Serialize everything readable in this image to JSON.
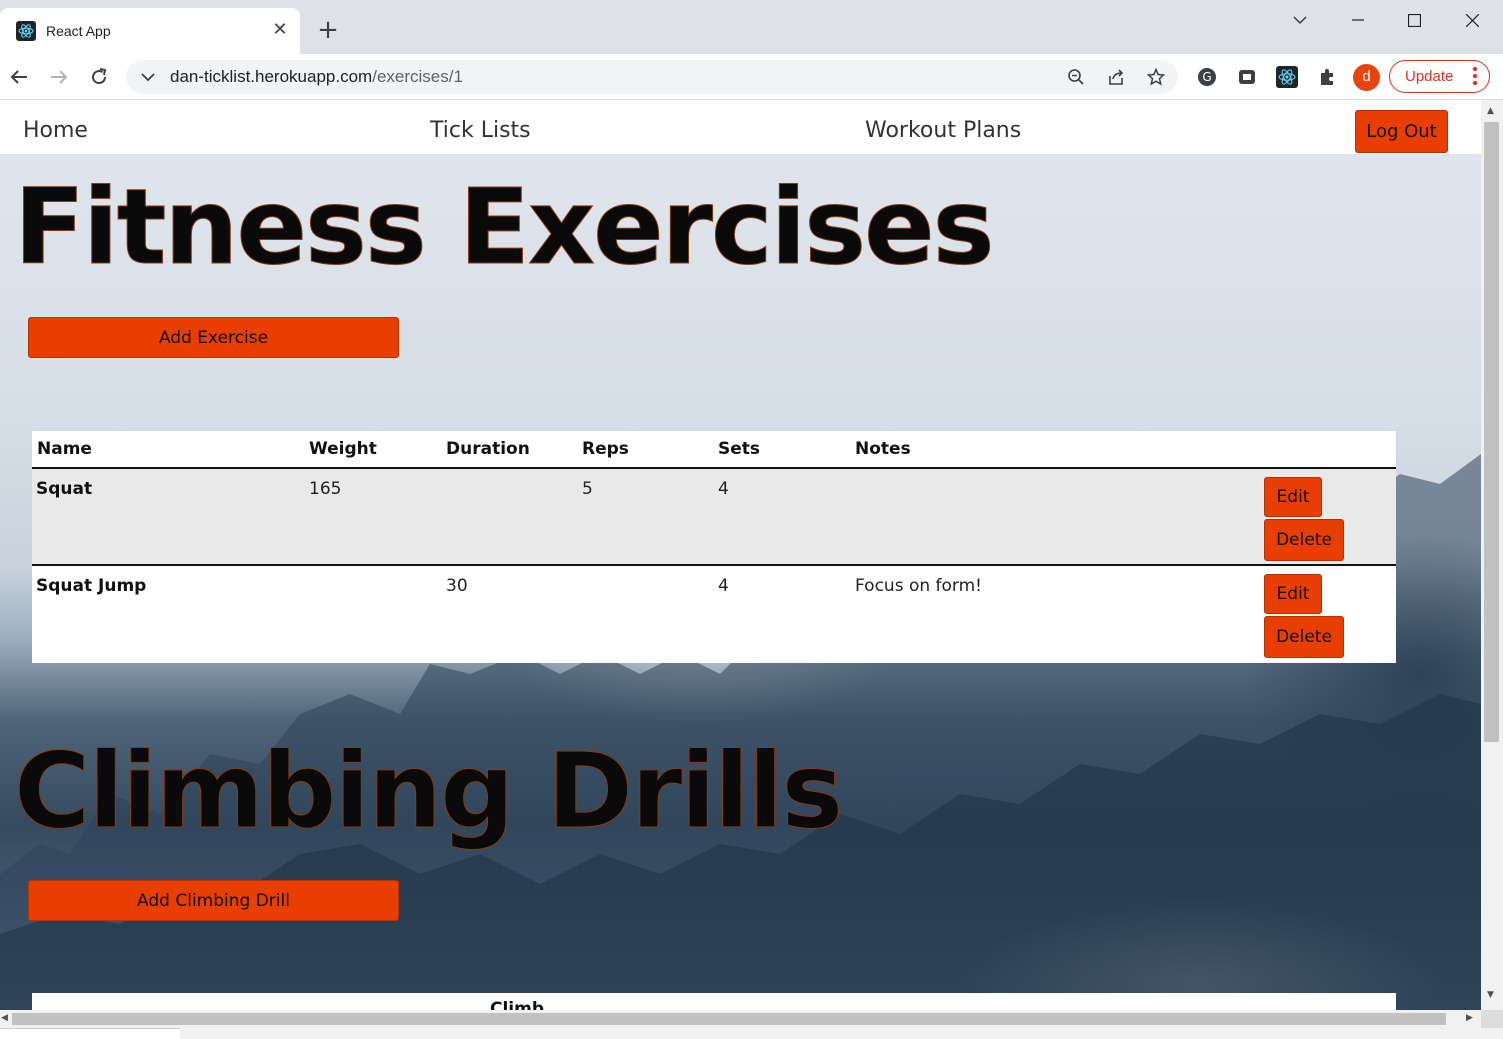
{
  "browser": {
    "tab_title": "React App",
    "close_glyph": "✕",
    "new_tab_glyph": "+",
    "url_host": "dan-ticklist.herokuapp.com",
    "url_path": "/exercises/1",
    "profile_initial": "d",
    "update_label": "Update"
  },
  "nav": {
    "home": "Home",
    "tick_lists": "Tick Lists",
    "workout_plans": "Workout Plans",
    "logout": "Log Out"
  },
  "fitness": {
    "heading": "Fitness Exercises",
    "add_label": "Add Exercise",
    "columns": [
      "Name",
      "Weight",
      "Duration",
      "Reps",
      "Sets",
      "Notes"
    ],
    "rows": [
      {
        "name": "Squat",
        "weight": "165",
        "duration": "",
        "reps": "5",
        "sets": "4",
        "notes": "",
        "edit": "Edit",
        "delete": "Delete"
      },
      {
        "name": "Squat Jump",
        "weight": "",
        "duration": "30",
        "reps": "",
        "sets": "4",
        "notes": "Focus on form!",
        "edit": "Edit",
        "delete": "Delete"
      }
    ]
  },
  "climbing": {
    "heading": "Climbing Drills",
    "add_label": "Add Climbing Drill",
    "partial_header": "Climb"
  },
  "colors": {
    "accent": "#e83e00",
    "chrome_bg": "#dee1e6",
    "update_red": "#d93025"
  }
}
